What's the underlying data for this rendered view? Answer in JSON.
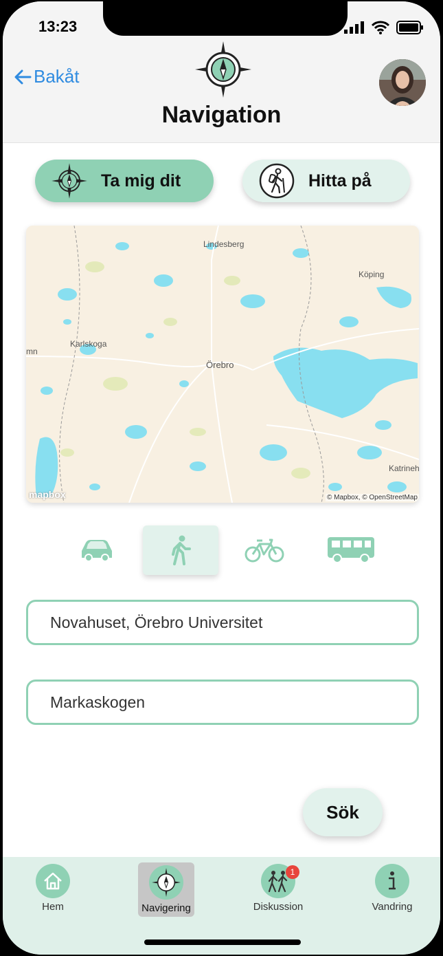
{
  "status": {
    "time": "13:23"
  },
  "header": {
    "back_label": "Bakåt",
    "title": "Navigation"
  },
  "toggle": {
    "take_me_label": "Ta mig dit",
    "find_label": "Hitta på",
    "selected": "take_me"
  },
  "map": {
    "places": [
      "Lindesberg",
      "Köping",
      "Karlskoga",
      "mn",
      "Örebro",
      "Katrineh"
    ],
    "logo_text": "mapbox",
    "attribution": "© Mapbox, © OpenStreetMap"
  },
  "modes": {
    "selected": "walk",
    "icons": [
      "car-icon",
      "walk-icon",
      "bicycle-icon",
      "bus-icon"
    ]
  },
  "form": {
    "from_value": "Novahuset, Örebro Universitet",
    "to_value": "Markaskogen",
    "search_label": "Sök"
  },
  "tabs": [
    {
      "label": "Hem",
      "icon": "home-icon"
    },
    {
      "label": "Navigering",
      "icon": "compass-icon"
    },
    {
      "label": "Diskussion",
      "icon": "hikers-icon",
      "badge": "1"
    },
    {
      "label": "Vandring",
      "icon": "info-icon"
    }
  ],
  "colors": {
    "accent": "#8fd1b4",
    "accent_light": "#e2f2ec",
    "link": "#2f8be0",
    "badge": "#e8453c"
  }
}
